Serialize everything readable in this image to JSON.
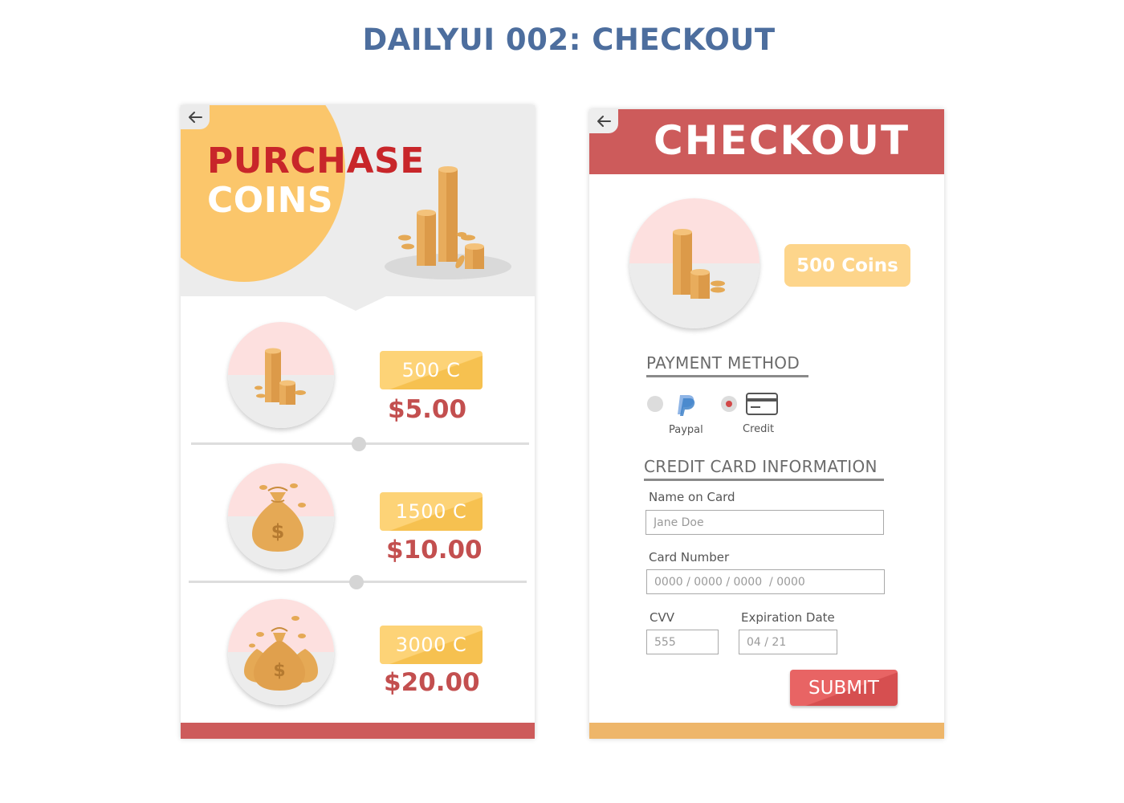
{
  "page": {
    "heading": "DAILYUI 002: CHECKOUT"
  },
  "purchase": {
    "title_line1": "PURCHASE",
    "title_line2": "COINS",
    "packages": [
      {
        "amount": "500 C",
        "price": "$5.00"
      },
      {
        "amount": "1500 C",
        "price": "$10.00"
      },
      {
        "amount": "3000 C",
        "price": "$20.00"
      }
    ]
  },
  "checkout": {
    "title": "CHECKOUT",
    "selected_amount": "500 Coins",
    "payment_heading": "PAYMENT METHOD",
    "payment_options": [
      {
        "label": "Paypal",
        "icon": "paypal-icon",
        "selected": false
      },
      {
        "label": "Credit",
        "icon": "credit-card-icon",
        "selected": true
      }
    ],
    "card_heading": "CREDIT CARD INFORMATION",
    "name_label": "Name on Card",
    "name_placeholder": "Jane Doe",
    "number_label": "Card Number",
    "number_placeholder": "0000 / 0000 / 0000  / 0000",
    "cvv_label": "CVV",
    "cvv_placeholder": "555",
    "expiry_label": "Expiration Date",
    "expiry_placeholder": "04 / 21",
    "submit_label": "SUBMIT"
  },
  "colors": {
    "heading": "#4d6e9e",
    "accent_red": "#cd5b5b",
    "accent_yellow": "#fbc66b",
    "price_red": "#c34f4f",
    "badge_yellow": "#fdd377"
  }
}
